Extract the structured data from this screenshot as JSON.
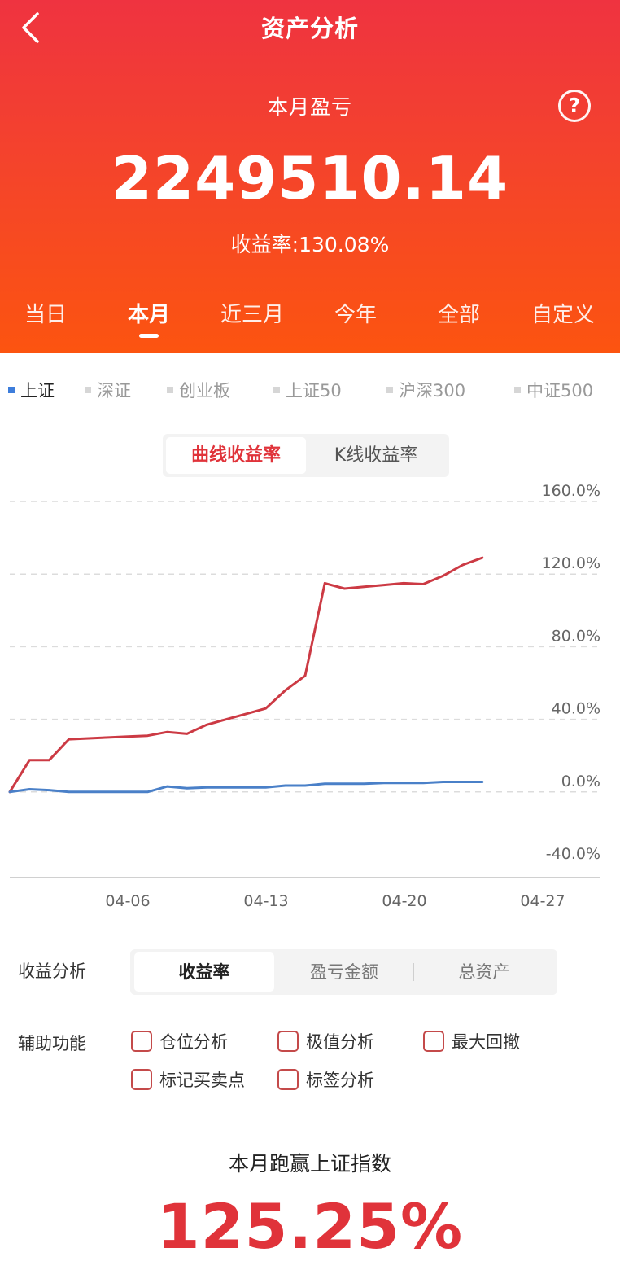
{
  "header": {
    "title": "资产分析",
    "pl_label": "本月盈亏",
    "pl_value": "2249510.14",
    "rate_label": "收益率:",
    "rate_value": "130.08%",
    "help_glyph": "?"
  },
  "period_tabs": [
    "当日",
    "本月",
    "近三月",
    "今年",
    "全部",
    "自定义"
  ],
  "active_period": "本月",
  "index_tabs": [
    "上证",
    "深证",
    "创业板",
    "上证50",
    "沪深300",
    "中证500"
  ],
  "active_index": "上证",
  "chart_mode": {
    "options": [
      "曲线收益率",
      "K线收益率"
    ],
    "active": "曲线收益率"
  },
  "chart_data": {
    "type": "line",
    "y_ticks": [
      "160.0%",
      "120.0%",
      "80.0%",
      "40.0%",
      "0.0%",
      "-40.0%"
    ],
    "x_ticks": [
      "04-06",
      "04-13",
      "04-20",
      "04-27"
    ],
    "ylim": [
      -40,
      160
    ],
    "grid": true,
    "series": [
      {
        "color": "#cc3a44",
        "points": [
          [
            0,
            0
          ],
          [
            1,
            17.5
          ],
          [
            2,
            17.5
          ],
          [
            3,
            29
          ],
          [
            4,
            29.5
          ],
          [
            5,
            30
          ],
          [
            6,
            30.5
          ],
          [
            7,
            31
          ],
          [
            8,
            33
          ],
          [
            9,
            32
          ],
          [
            10,
            37
          ],
          [
            11,
            40
          ],
          [
            12,
            43
          ],
          [
            13,
            46
          ],
          [
            14,
            56
          ],
          [
            15,
            64
          ],
          [
            16,
            115
          ],
          [
            17,
            112
          ],
          [
            18,
            113
          ],
          [
            19,
            114
          ],
          [
            20,
            115
          ],
          [
            21,
            114.5
          ],
          [
            22,
            119
          ],
          [
            23,
            125
          ],
          [
            24,
            129
          ]
        ]
      },
      {
        "color": "#4a80c8",
        "points": [
          [
            0,
            0
          ],
          [
            1,
            1.5
          ],
          [
            2,
            1
          ],
          [
            3,
            0
          ],
          [
            4,
            0
          ],
          [
            5,
            0
          ],
          [
            6,
            0
          ],
          [
            7,
            0
          ],
          [
            8,
            3
          ],
          [
            9,
            2
          ],
          [
            10,
            2.5
          ],
          [
            11,
            2.5
          ],
          [
            12,
            2.5
          ],
          [
            13,
            2.5
          ],
          [
            14,
            3.5
          ],
          [
            15,
            3.5
          ],
          [
            16,
            4.5
          ],
          [
            17,
            4.5
          ],
          [
            18,
            4.5
          ],
          [
            19,
            5
          ],
          [
            20,
            5
          ],
          [
            21,
            5
          ],
          [
            22,
            5.5
          ],
          [
            23,
            5.5
          ],
          [
            24,
            5.5
          ]
        ]
      }
    ]
  },
  "analysis": {
    "label": "收益分析",
    "options": [
      "收益率",
      "盈亏金额",
      "总资产"
    ],
    "active": "收益率"
  },
  "aux": {
    "label": "辅助功能",
    "options": [
      "仓位分析",
      "极值分析",
      "最大回撤",
      "标记买卖点",
      "标签分析"
    ]
  },
  "beat": {
    "label": "本月跑赢上证指数",
    "value": "125.25%"
  },
  "colors": {
    "brand_red": "#e0333a",
    "header_top": "#ef3340",
    "header_bottom": "#fc5410",
    "index_blue": "#3d7ddb"
  }
}
